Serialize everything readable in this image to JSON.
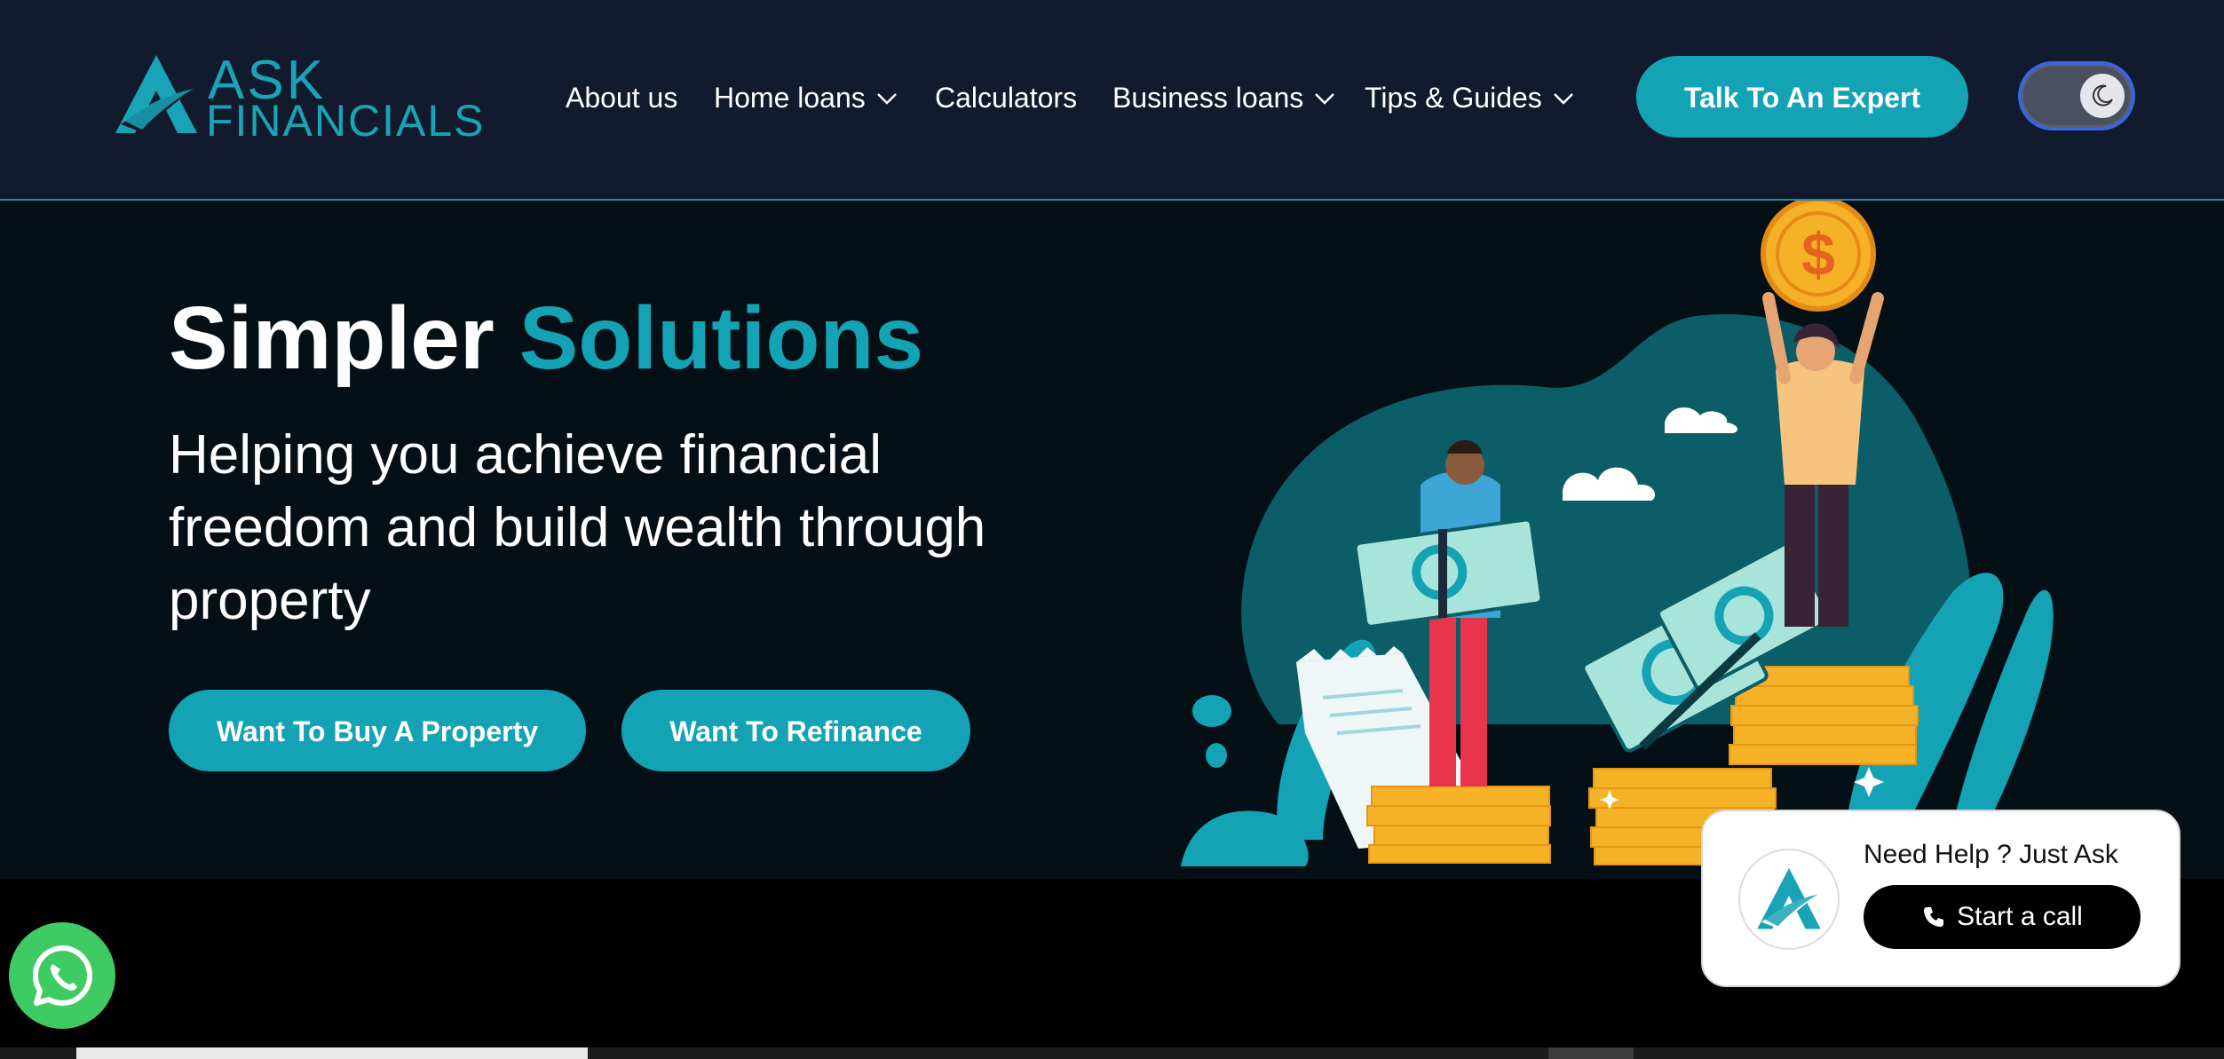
{
  "header": {
    "logo_line1": "ASK",
    "logo_line2": "FINANCIALS",
    "nav": [
      {
        "label": "About us"
      },
      {
        "label": "Home loans"
      },
      {
        "label": "Calculators"
      },
      {
        "label": "Business loans"
      },
      {
        "label": "Tips & Guides"
      }
    ],
    "cta_label": "Talk To An Expert",
    "theme_toggle_icon": "moon-icon"
  },
  "hero": {
    "title_plain": "Simpler",
    "title_accent": "Solutions",
    "subtitle": "Helping you achieve financial freedom and build wealth through property",
    "buttons": [
      {
        "label": "Want To Buy A Property"
      },
      {
        "label": "Want To Refinance"
      }
    ]
  },
  "help_widget": {
    "title": "Need Help ? Just Ask",
    "call_label": "Start a call"
  },
  "colors": {
    "accent": "#14a3b5",
    "header_bg": "#121a2d",
    "hero_bg": "#041015",
    "whatsapp": "#3fcb63"
  }
}
